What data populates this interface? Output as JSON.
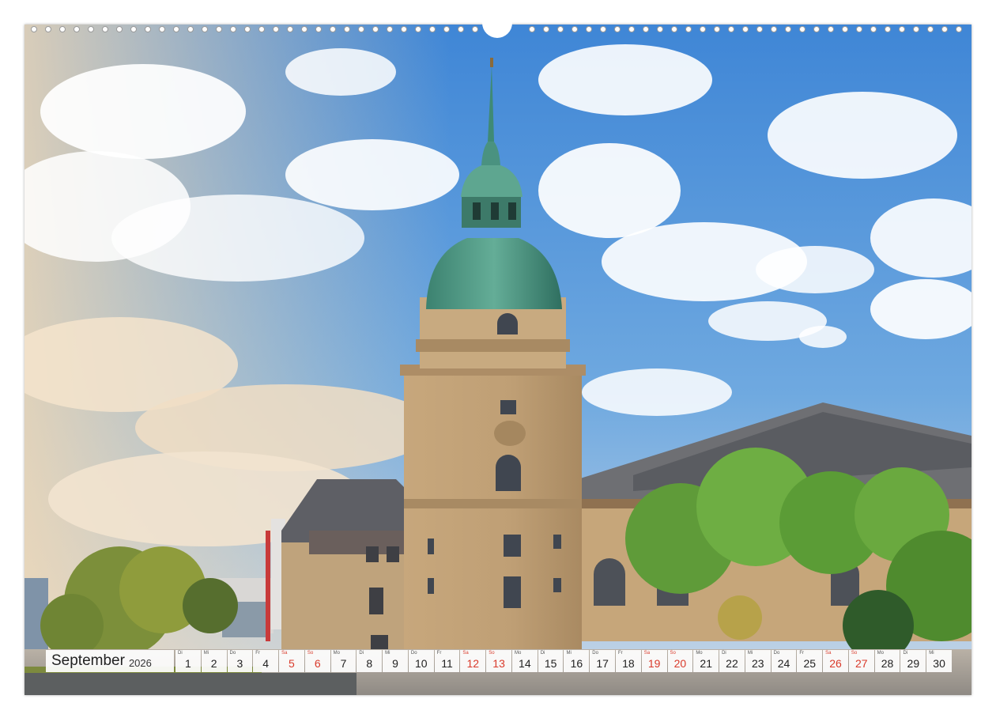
{
  "calendar": {
    "month": "September",
    "year": "2026",
    "days": [
      {
        "number": "1",
        "weekday": "Di",
        "weekend": false
      },
      {
        "number": "2",
        "weekday": "Mi",
        "weekend": false
      },
      {
        "number": "3",
        "weekday": "Do",
        "weekend": false
      },
      {
        "number": "4",
        "weekday": "Fr",
        "weekend": false
      },
      {
        "number": "5",
        "weekday": "Sa",
        "weekend": true
      },
      {
        "number": "6",
        "weekday": "So",
        "weekend": true
      },
      {
        "number": "7",
        "weekday": "Mo",
        "weekend": false
      },
      {
        "number": "8",
        "weekday": "Di",
        "weekend": false
      },
      {
        "number": "9",
        "weekday": "Mi",
        "weekend": false
      },
      {
        "number": "10",
        "weekday": "Do",
        "weekend": false
      },
      {
        "number": "11",
        "weekday": "Fr",
        "weekend": false
      },
      {
        "number": "12",
        "weekday": "Sa",
        "weekend": true
      },
      {
        "number": "13",
        "weekday": "So",
        "weekend": true
      },
      {
        "number": "14",
        "weekday": "Mo",
        "weekend": false
      },
      {
        "number": "15",
        "weekday": "Di",
        "weekend": false
      },
      {
        "number": "16",
        "weekday": "Mi",
        "weekend": false
      },
      {
        "number": "17",
        "weekday": "Do",
        "weekend": false
      },
      {
        "number": "18",
        "weekday": "Fr",
        "weekend": false
      },
      {
        "number": "19",
        "weekday": "Sa",
        "weekend": true
      },
      {
        "number": "20",
        "weekday": "So",
        "weekend": true
      },
      {
        "number": "21",
        "weekday": "Mo",
        "weekend": false
      },
      {
        "number": "22",
        "weekday": "Di",
        "weekend": false
      },
      {
        "number": "23",
        "weekday": "Mi",
        "weekend": false
      },
      {
        "number": "24",
        "weekday": "Do",
        "weekend": false
      },
      {
        "number": "25",
        "weekday": "Fr",
        "weekend": false
      },
      {
        "number": "26",
        "weekday": "Sa",
        "weekend": true
      },
      {
        "number": "27",
        "weekday": "So",
        "weekend": true
      },
      {
        "number": "28",
        "weekday": "Mo",
        "weekend": false
      },
      {
        "number": "29",
        "weekday": "Di",
        "weekend": false
      },
      {
        "number": "30",
        "weekday": "Mi",
        "weekend": false
      }
    ]
  },
  "colors": {
    "weekend_text": "#d93a2b",
    "weekday_text": "#222222",
    "cell_background": "#ffffff",
    "sky": "#4f93d8",
    "copper_roof": "#4f9a85",
    "sandstone": "#c4a57c"
  }
}
